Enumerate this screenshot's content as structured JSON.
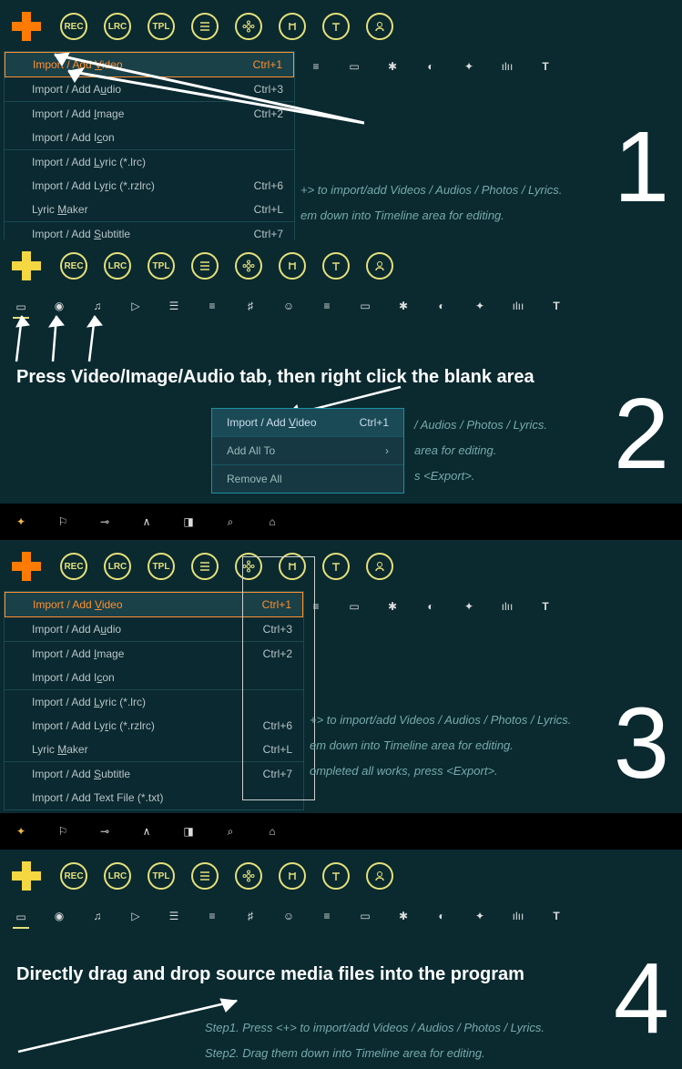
{
  "toolbar_circles": [
    "REC",
    "LRC",
    "TPL",
    "list",
    "flower",
    "music",
    "text",
    "person"
  ],
  "tab_icons": [
    "video",
    "camera",
    "music",
    "clip",
    "layers",
    "list",
    "note",
    "smile",
    "bars",
    "battery",
    "sparkle",
    "contrast",
    "puzzle",
    "wave",
    "T"
  ],
  "extra_top_icons": [
    "wand",
    "flag",
    "key",
    "peak",
    "panel",
    "search",
    "shirt"
  ],
  "panel1": {
    "number": "1",
    "menu_items": [
      {
        "label": [
          "Import / Add ",
          "V",
          "ideo"
        ],
        "short": "Ctrl+1",
        "hl": true
      },
      {
        "label": [
          "Import / Add A",
          "u",
          "dio"
        ],
        "short": "Ctrl+3"
      },
      {
        "sep": true
      },
      {
        "label": [
          "Import / Add ",
          "I",
          "mage"
        ],
        "short": "Ctrl+2"
      },
      {
        "label": [
          "Import / Add I",
          "c",
          "on"
        ],
        "short": ""
      },
      {
        "sep": true
      },
      {
        "label": [
          "Import / Add ",
          "L",
          "yric (*.lrc)"
        ],
        "short": ""
      },
      {
        "label": [
          "Import / Add Ly",
          "r",
          "ic (*.rzlrc)"
        ],
        "short": "Ctrl+6"
      },
      {
        "label": [
          "Lyric ",
          "M",
          "aker"
        ],
        "short": "Ctrl+L"
      },
      {
        "sep": true
      },
      {
        "label": [
          "Import / Add ",
          "S",
          "ubtitle"
        ],
        "short": "Ctrl+7"
      }
    ],
    "steps": [
      "+> to import/add Videos / Audios / Photos / Lyrics.",
      "em down into Timeline area for editing."
    ]
  },
  "panel2": {
    "number": "2",
    "caption": "Press Video/Image/Audio tab, then right click the blank area",
    "ctx": [
      {
        "label": [
          "Import / Add ",
          "V",
          "ideo"
        ],
        "short": "Ctrl+1",
        "hl": true
      },
      {
        "sep": true
      },
      {
        "label_plain": "Add All To",
        "arrow": true
      },
      {
        "sep": true
      },
      {
        "label_plain": "Remove All"
      }
    ],
    "bg_line": "/ Audios / Photos / Lyrics.",
    "bg_line2": "area for editing.",
    "bg_line3": "s <Export>."
  },
  "panel3": {
    "number": "3",
    "menu_items": [
      {
        "label": [
          "Import / Add ",
          "V",
          "ideo"
        ],
        "short": "Ctrl+1",
        "hl": true
      },
      {
        "label": [
          "Import / Add A",
          "u",
          "dio"
        ],
        "short": "Ctrl+3"
      },
      {
        "sep": true
      },
      {
        "label": [
          "Import / Add ",
          "I",
          "mage"
        ],
        "short": "Ctrl+2"
      },
      {
        "label": [
          "Import / Add I",
          "c",
          "on"
        ],
        "short": ""
      },
      {
        "sep": true
      },
      {
        "label": [
          "Import / Add ",
          "L",
          "yric (*.lrc)"
        ],
        "short": ""
      },
      {
        "label": [
          "Import / Add Ly",
          "r",
          "ic (*.rzlrc)"
        ],
        "short": "Ctrl+6"
      },
      {
        "label": [
          "Lyric ",
          "M",
          "aker"
        ],
        "short": "Ctrl+L"
      },
      {
        "sep": true
      },
      {
        "label": [
          "Import / Add ",
          "S",
          "ubtitle"
        ],
        "short": "Ctrl+7"
      },
      {
        "label_plain": "Import / Add Text File (*.txt)",
        "short": ""
      }
    ],
    "steps": [
      "+> to import/add Videos / Audios / Photos / Lyrics.",
      "em down into Timeline area for editing.",
      "ompleted all works, press <Export>."
    ]
  },
  "panel4": {
    "number": "4",
    "caption": "Directly drag and drop source media files into the program",
    "steps": [
      "Step1. Press <+> to import/add Videos / Audios / Photos / Lyrics.",
      "Step2. Drag them down into Timeline area for editing."
    ]
  }
}
